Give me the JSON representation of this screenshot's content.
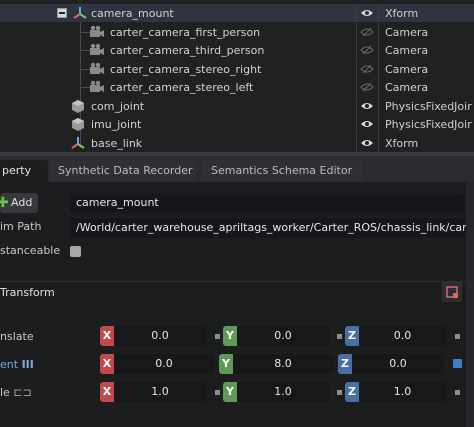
{
  "stage": {
    "rows": [
      {
        "label": "camera_mount",
        "type": "Xform",
        "icon": "xform-icon",
        "selected": true,
        "indent": 91
      },
      {
        "label": "carter_camera_first_person",
        "type": "Camera",
        "icon": "camera-icon",
        "indent": 110
      },
      {
        "label": "carter_camera_third_person",
        "type": "Camera",
        "icon": "camera-icon",
        "indent": 110
      },
      {
        "label": "carter_camera_stereo_right",
        "type": "Camera",
        "icon": "camera-icon",
        "indent": 110
      },
      {
        "label": "carter_camera_stereo_left",
        "type": "Camera",
        "icon": "camera-icon",
        "indent": 110
      },
      {
        "label": "com_joint",
        "type": "PhysicsFixedJoir",
        "icon": "joint-icon",
        "indent": 91
      },
      {
        "label": "imu_joint",
        "type": "PhysicsFixedJoir",
        "icon": "joint-icon",
        "indent": 91
      },
      {
        "label": "base_link",
        "type": "Xform",
        "icon": "xform-icon",
        "indent": 91
      }
    ]
  },
  "tabs": [
    {
      "label": "perty",
      "active": true
    },
    {
      "label": "Synthetic Data Recorder"
    },
    {
      "label": "Semantics Schema Editor"
    }
  ],
  "property": {
    "add_label": "Add",
    "name_value": "camera_mount",
    "prim_path_label": "im Path",
    "prim_path_value": "/World/carter_warehouse_apriltags_worker/Carter_ROS/chassis_link/camera_m",
    "instanceable_label": "stanceable",
    "section_title": "Transform",
    "rows": [
      {
        "label": "nslate",
        "x": "0.0",
        "y": "0.0",
        "z": "0.0"
      },
      {
        "label": "ent",
        "x": "0.0",
        "y": "8.0",
        "z": "0.0"
      },
      {
        "label": "le",
        "x": "1.0",
        "y": "1.0",
        "z": "1.0"
      }
    ],
    "axis_x": "X",
    "axis_y": "Y",
    "axis_z": "Z"
  },
  "colors": {
    "accent_x": "#c14a4a",
    "accent_y": "#5e9a55",
    "accent_z": "#4a6fa3"
  }
}
